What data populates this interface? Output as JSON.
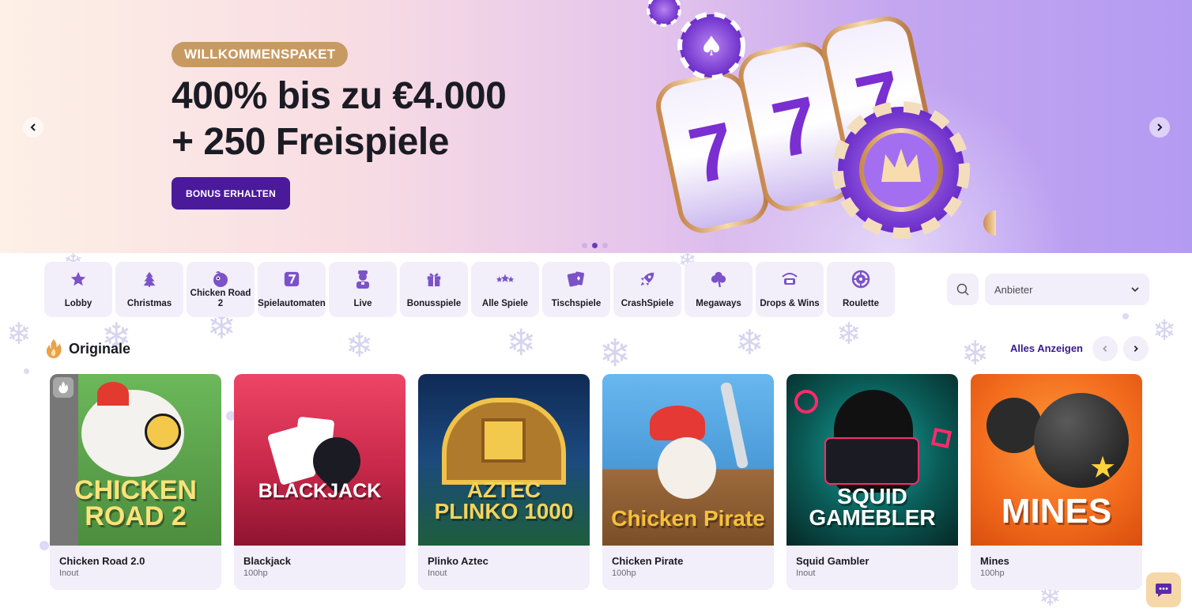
{
  "hero": {
    "badge": "WILLKOMMENSPAKET",
    "title_line1": "400% bis zu €4.000",
    "title_line2": "+ 250 Freispiele",
    "cta": "BONUS ERHALTEN",
    "dots": 3,
    "active_dot": 2
  },
  "categories": [
    {
      "label": "Lobby",
      "icon": "star-icon"
    },
    {
      "label": "Christmas",
      "icon": "tree-icon"
    },
    {
      "label": "Chicken Road 2",
      "icon": "chicken-icon"
    },
    {
      "label": "Spielautomaten",
      "icon": "slot-seven-icon"
    },
    {
      "label": "Live",
      "icon": "dealer-icon"
    },
    {
      "label": "Bonusspiele",
      "icon": "gift-icon"
    },
    {
      "label": "Alle Spiele",
      "icon": "stars-icon"
    },
    {
      "label": "Tischspiele",
      "icon": "cards-icon"
    },
    {
      "label": "CrashSpiele",
      "icon": "rocket-icon"
    },
    {
      "label": "Megaways",
      "icon": "clover-icon"
    },
    {
      "label": "Drops & Wins",
      "icon": "drops-wins-icon"
    },
    {
      "label": "Roulette",
      "icon": "roulette-icon"
    }
  ],
  "provider_select": {
    "value": "Anbieter"
  },
  "section": {
    "title": "Originale",
    "see_all": "Alles Anzeigen"
  },
  "games": [
    {
      "name": "Chicken Road 2.0",
      "provider": "Inout",
      "logo": "CHICKEN ROAD 2",
      "bg": "#58a34a"
    },
    {
      "name": "Blackjack",
      "provider": "100hp",
      "logo": "BLACKJACK",
      "bg": "#e8395a"
    },
    {
      "name": "Plinko Aztec",
      "provider": "Inout",
      "logo": "AZTEC PLINKO 1000",
      "bg": "#1c3b6e"
    },
    {
      "name": "Chicken Pirate",
      "provider": "100hp",
      "logo": "Chicken Pirate",
      "bg": "#5aa7e8"
    },
    {
      "name": "Squid Gambler",
      "provider": "Inout",
      "logo": "SQUID GAMEBLER",
      "bg": "#0c6a64"
    },
    {
      "name": "Mines",
      "provider": "100hp",
      "logo": "MINES",
      "bg": "#f26a1c"
    }
  ],
  "colors": {
    "accent": "#4a1a9b",
    "badge": "#c79a62",
    "tile_bg": "#f2eefa"
  }
}
